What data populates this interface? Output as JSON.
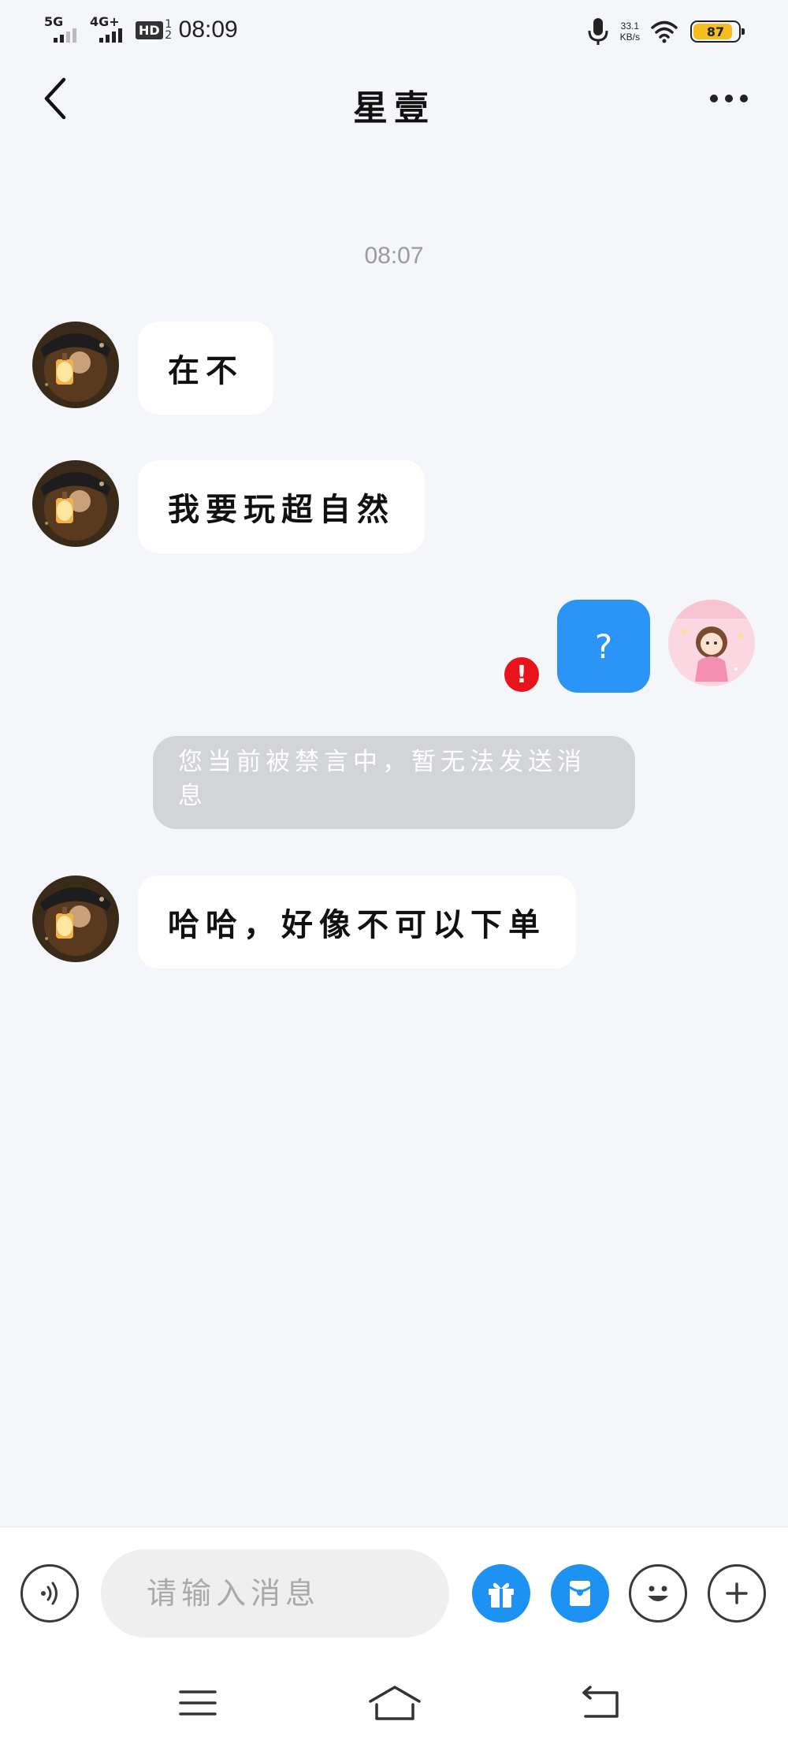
{
  "status_bar": {
    "signal1_label": "5G",
    "signal2_label": "4G+",
    "hd_label": "HD",
    "hd_sub_top": "1",
    "hd_sub_bottom": "2",
    "time": "08:09",
    "net_speed_value": "33.1",
    "net_speed_unit": "KB/s",
    "battery_percent": "87",
    "battery_level": 0.87,
    "battery_color": "#f5bd1f"
  },
  "header": {
    "title": "星壹",
    "back_icon": "chevron-left-icon",
    "more_icon": "more-horizontal-icon"
  },
  "chat": {
    "timestamp": "08:07",
    "messages": [
      {
        "direction": "incoming",
        "text": "在不"
      },
      {
        "direction": "incoming",
        "text": "我要玩超自然"
      },
      {
        "direction": "outgoing",
        "text": "?",
        "status": "failed",
        "status_icon": "!"
      },
      {
        "direction": "system",
        "text": "您当前被禁言中，暂无法发送消息"
      },
      {
        "direction": "incoming",
        "text": "哈哈，好像不可以下单"
      }
    ],
    "outgoing_bubble_color": "#2b95f7",
    "error_color": "#e8141b"
  },
  "input_bar": {
    "placeholder": "请输入消息",
    "value": "",
    "voice_icon": "voice-icon",
    "gift_icon": "gift-icon",
    "red_packet_icon": "red-packet-icon",
    "emoji_icon": "emoji-icon",
    "plus_icon": "plus-icon",
    "accent_color": "#1d92f2"
  },
  "nav_bar": {
    "menu_icon": "menu-icon",
    "home_icon": "home-icon",
    "back_icon": "back-arrow-icon"
  }
}
